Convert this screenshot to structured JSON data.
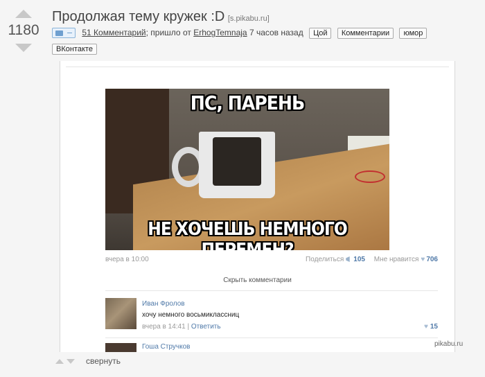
{
  "post": {
    "score": "1180",
    "title": "Продолжая тему кружек :D",
    "domain": "[s.pikabu.ru]",
    "badge_dash": "–",
    "comments_link": "51 Комментарий",
    "meta_semicolon": ";",
    "from_text": "пришло от",
    "author": "ErhogTemnaja",
    "time_ago": "7 часов назад",
    "tags": [
      "Цой",
      "Комментарии",
      "юмор",
      "ВКонтакте"
    ]
  },
  "meme": {
    "top_text": "ПС, ПАРЕНЬ",
    "bottom_text": "НЕ ХОЧЕШЬ НЕМНОГО ПЕРЕМЕН?"
  },
  "vk_post": {
    "time": "вчера в 10:00",
    "share_label": "Поделиться",
    "share_count": "105",
    "like_label": "Мне нравится",
    "like_count": "706",
    "hide_comments": "Скрыть комментарии"
  },
  "comments": [
    {
      "name": "Иван Фролов",
      "text": "хочу немного восьмиклассниц",
      "time": "вчера в 14:41",
      "separator": "|",
      "reply": "Ответить",
      "likes": "15"
    },
    {
      "name": "Гоша Стручков"
    }
  ],
  "watermark": "pikabu.ru",
  "footer": {
    "collapse": "свернуть"
  },
  "colors": {
    "link_blue": "#4f79a8",
    "arrow_grey": "#c8c8c8"
  }
}
